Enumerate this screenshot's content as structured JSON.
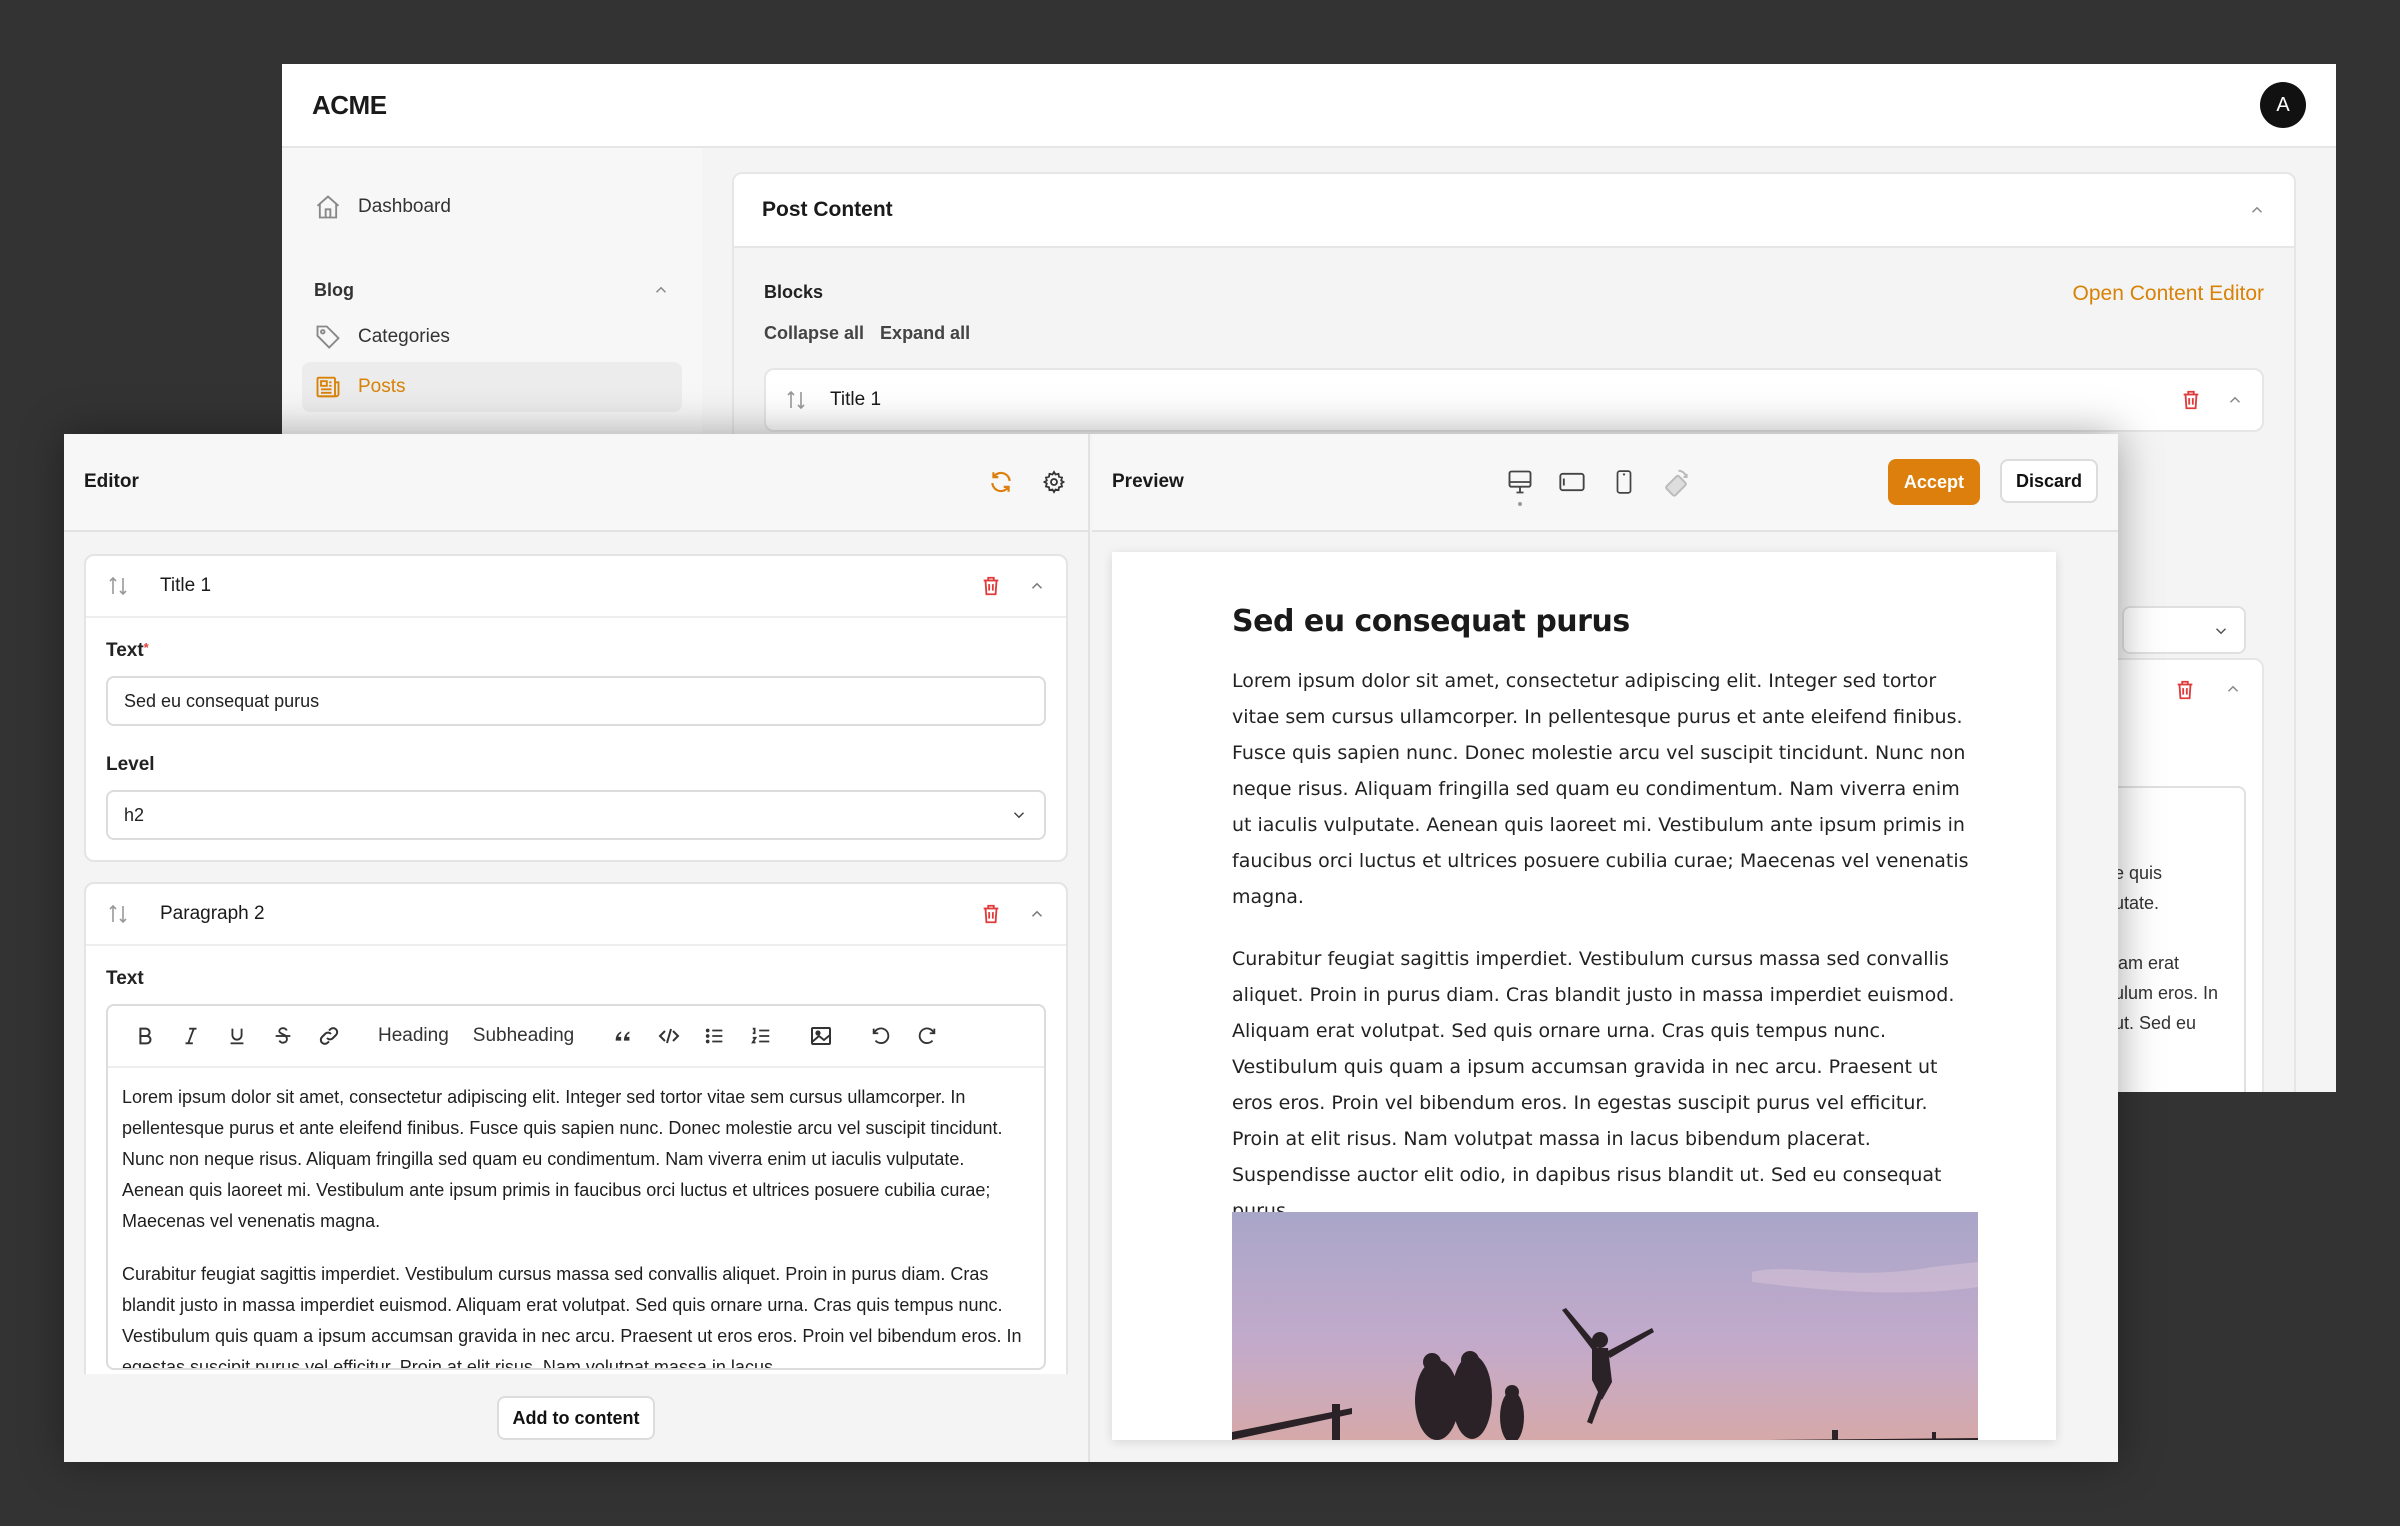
{
  "admin": {
    "logo": "ACME",
    "avatar_initial": "A",
    "sidebar": {
      "dashboard": "Dashboard",
      "group": "Blog",
      "categories": "Categories",
      "posts": "Posts"
    },
    "post_content": {
      "title": "Post Content",
      "blocks_label": "Blocks",
      "open_editor": "Open Content Editor",
      "collapse_all": "Collapse all",
      "expand_all": "Expand all",
      "block1_title": "Title 1",
      "peek_lines": [
        "e quis",
        "utate.",
        "",
        "iam erat",
        "ulum eros. In",
        "ut. Sed eu"
      ]
    }
  },
  "editor": {
    "title": "Editor",
    "blocks": [
      {
        "title": "Title 1",
        "text_label": "Text",
        "text_value": "Sed eu consequat purus",
        "level_label": "Level",
        "level_value": "h2"
      },
      {
        "title": "Paragraph 2",
        "text_label": "Text",
        "toolbar": {
          "heading": "Heading",
          "subheading": "Subheading"
        },
        "paragraphs": [
          "Lorem ipsum dolor sit amet, consectetur adipiscing elit. Integer sed tortor vitae sem cursus ullamcorper. In pellentesque purus et ante eleifend finibus. Fusce quis sapien nunc. Donec molestie arcu vel suscipit tincidunt. Nunc non neque risus. Aliquam fringilla sed quam eu condimentum. Nam viverra enim ut iaculis vulputate. Aenean quis laoreet mi. Vestibulum ante ipsum primis in faucibus orci luctus et ultrices posuere cubilia curae; Maecenas vel venenatis magna.",
          "Curabitur feugiat sagittis imperdiet. Vestibulum cursus massa sed convallis aliquet. Proin in purus diam. Cras blandit justo in massa imperdiet euismod. Aliquam erat volutpat. Sed quis ornare urna. Cras quis tempus nunc. Vestibulum quis quam a ipsum accumsan gravida in nec arcu. Praesent ut eros eros. Proin vel bibendum eros. In egestas suscipit purus vel efficitur. Proin at elit risus. Nam volutpat massa in lacus"
        ]
      }
    ],
    "add_to_content": "Add to content"
  },
  "preview": {
    "title": "Preview",
    "accept": "Accept",
    "discard": "Discard",
    "heading": "Sed eu consequat purus",
    "paragraphs": [
      "Lorem ipsum dolor sit amet, consectetur adipiscing elit. Integer sed tortor vitae sem cursus ullamcorper. In pellentesque purus et ante eleifend finibus. Fusce quis sapien nunc. Donec molestie arcu vel suscipit tincidunt. Nunc non neque risus. Aliquam fringilla sed quam eu condimentum. Nam viverra enim ut iaculis vulputate. Aenean quis laoreet mi. Vestibulum ante ipsum primis in faucibus orci luctus et ultrices posuere cubilia curae; Maecenas vel venenatis magna.",
      "Curabitur feugiat sagittis imperdiet. Vestibulum cursus massa sed convallis aliquet. Proin in purus diam. Cras blandit justo in massa imperdiet euismod. Aliquam erat volutpat. Sed quis ornare urna. Cras quis tempus nunc. Vestibulum quis quam a ipsum accumsan gravida in nec arcu. Praesent ut eros eros. Proin vel bibendum eros. In egestas suscipit purus vel efficitur. Proin at elit risus. Nam volutpat massa in lacus bibendum placerat. Suspendisse auctor elit odio, in dapibus risus blandit ut. Sed eu consequat purus."
    ]
  },
  "colors": {
    "accent": "#dd7f0c",
    "danger": "#e03b3b",
    "backdrop": "#333333"
  },
  "icons": [
    "home-icon",
    "tag-icon",
    "newspaper-icon",
    "chevron-up-icon",
    "chevron-down-icon",
    "reorder-icon",
    "trash-icon",
    "refresh-icon",
    "gear-icon",
    "desktop-icon",
    "tablet-icon",
    "phone-icon",
    "rotate-icon"
  ]
}
